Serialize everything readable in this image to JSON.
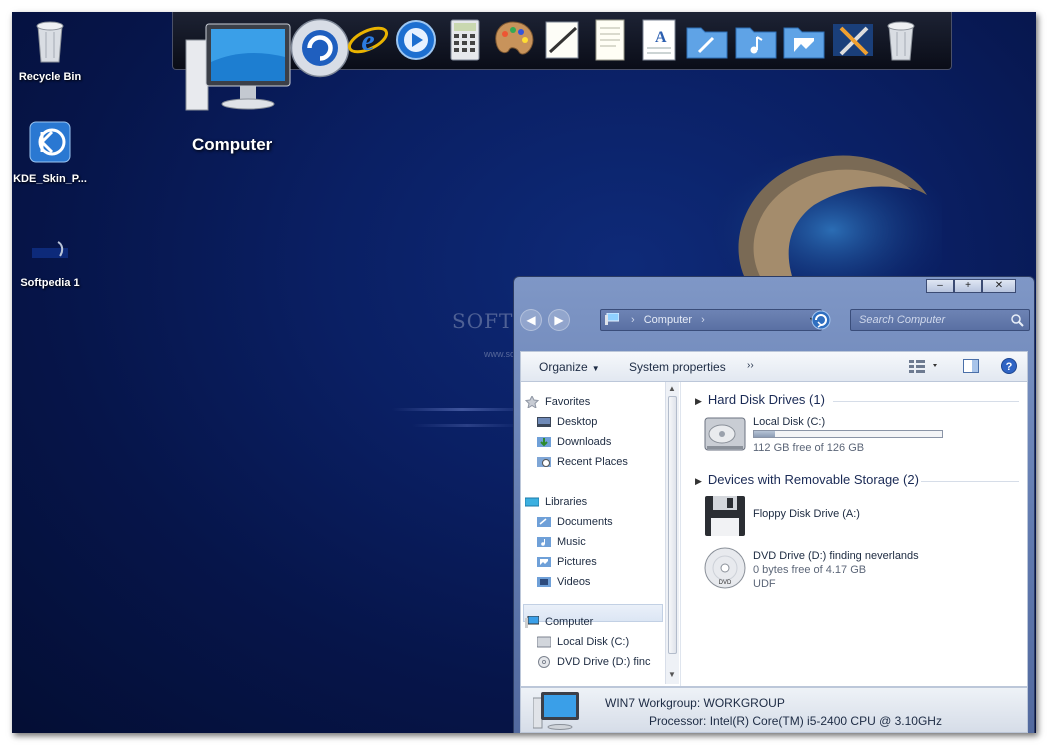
{
  "desktop": {
    "icons": [
      {
        "label": "Recycle Bin",
        "icon": "recycle-bin-icon"
      },
      {
        "label": "KDE_Skin_P...",
        "icon": "kde-icon"
      },
      {
        "label": "Softpedia 1",
        "icon": "softpedia-icon"
      }
    ],
    "dock_caption": "Computer",
    "dock_items": [
      "computer-icon",
      "kde-settings-icon",
      "internet-explorer-icon",
      "media-player-icon",
      "calculator-icon",
      "paint-palette-icon",
      "notepad-icon",
      "document-icon",
      "wordpad-icon",
      "documents-folder-icon",
      "music-folder-icon",
      "pictures-folder-icon",
      "tools-icon",
      "trash-icon"
    ]
  },
  "watermark": {
    "text": "SOFTPEDIA",
    "sub": "www.softpedia.com"
  },
  "explorer": {
    "window_controls": {
      "minimize": "–",
      "maximize": "+",
      "close": "✕"
    },
    "address": {
      "crumb": "Computer",
      "sep": "›"
    },
    "search": {
      "placeholder": "Search Computer"
    },
    "toolbar": {
      "organize": "Organize",
      "system_properties": "System properties",
      "more": "››"
    },
    "nav": {
      "favorites": "Favorites",
      "desktop": "Desktop",
      "downloads": "Downloads",
      "recent_places": "Recent Places",
      "libraries": "Libraries",
      "documents": "Documents",
      "music": "Music",
      "pictures": "Pictures",
      "videos": "Videos",
      "computer": "Computer",
      "local_disk": "Local Disk (C:)",
      "dvd_drive": "DVD Drive (D:) finc"
    },
    "groups": {
      "hard_disk": "Hard Disk Drives (1)",
      "removable": "Devices with Removable Storage (2)"
    },
    "drives": {
      "local_disk": {
        "name": "Local Disk (C:)",
        "free": "112 GB free of 126 GB",
        "used_fraction": 0.111
      },
      "floppy": {
        "name": "Floppy Disk Drive (A:)"
      },
      "dvd": {
        "name": "DVD Drive (D:) finding neverlands",
        "free": "0 bytes free of 4.17 GB",
        "fs": "UDF"
      }
    },
    "details": {
      "name": "WIN7",
      "workgroup_key": "Workgroup:",
      "workgroup": "WORKGROUP",
      "processor_key": "Processor:",
      "processor": "Intel(R) Core(TM) i5-2400 CPU @ 3.10GHz"
    }
  }
}
